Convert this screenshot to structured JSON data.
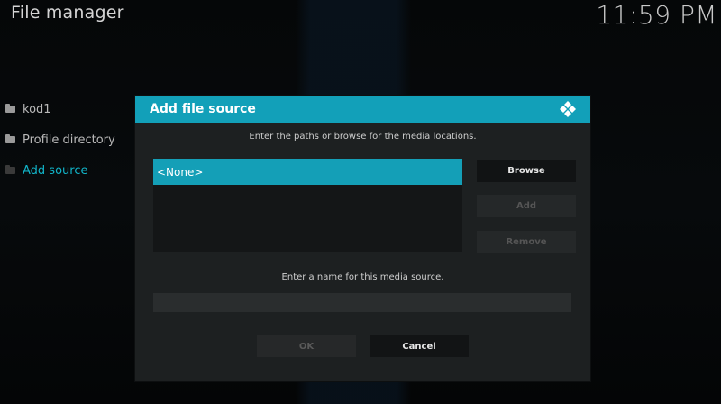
{
  "window": {
    "title": "File manager",
    "clock": "11:59 PM"
  },
  "sources": [
    {
      "label": "kod1",
      "icon": "folder-icon"
    },
    {
      "label": "Profile directory",
      "icon": "folder-icon"
    },
    {
      "label": "Add source",
      "icon": "folder-icon",
      "active": true
    }
  ],
  "dialog": {
    "title": "Add file source",
    "logo": "kodi-logo-icon",
    "paths_instruction": "Enter the paths or browse for the media locations.",
    "paths": [
      "<None>"
    ],
    "buttons": {
      "browse": "Browse",
      "add": "Add",
      "remove": "Remove"
    },
    "name_instruction": "Enter a name for this media source.",
    "name_value": "",
    "footer": {
      "ok": "OK",
      "cancel": "Cancel"
    }
  },
  "colors": {
    "accent": "#12a0b9",
    "active_text": "#11b5c9"
  }
}
